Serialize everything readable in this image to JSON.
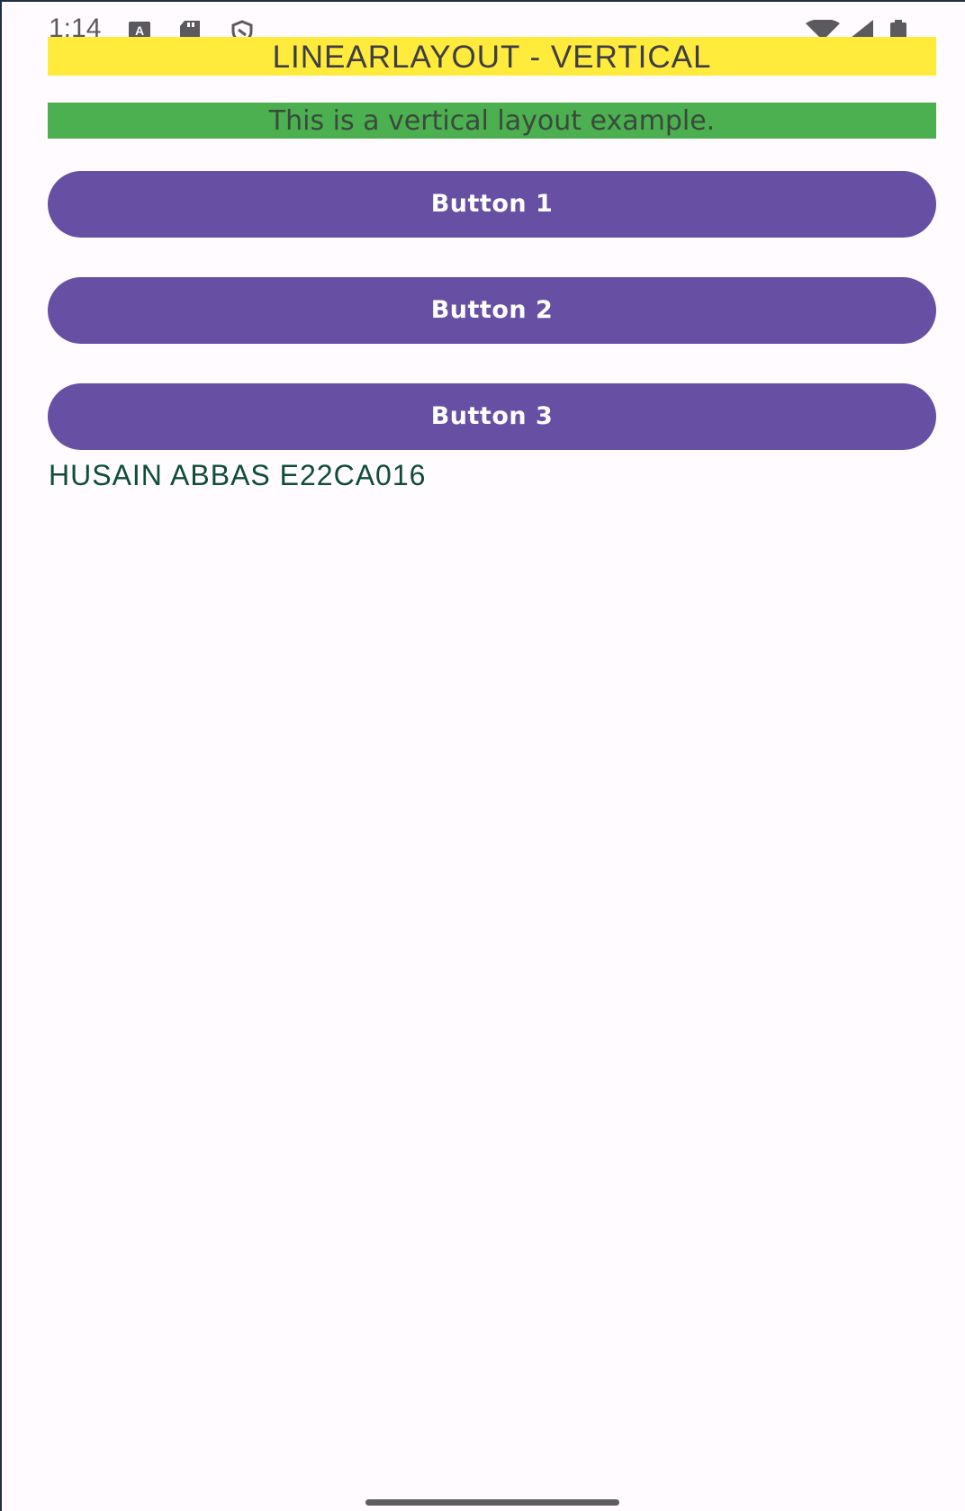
{
  "status_bar": {
    "time": "1:14",
    "left_icons": [
      "keyboard-a-icon",
      "sd-card-icon",
      "shield-icon"
    ],
    "right_icons": [
      "wifi-icon",
      "cell-signal-icon",
      "battery-icon"
    ]
  },
  "header": {
    "title": "LINEARLAYOUT - VERTICAL",
    "title_bg": "#ffeb3b"
  },
  "subtitle": {
    "text": "This is a vertical layout example.",
    "bg": "#4caf50"
  },
  "buttons": [
    {
      "label": "Button 1"
    },
    {
      "label": "Button 2"
    },
    {
      "label": "Button 3"
    }
  ],
  "button_color": "#674fa3",
  "footer_label": {
    "text": "HUSAIN ABBAS E22CA016",
    "color": "#0f4d38"
  }
}
